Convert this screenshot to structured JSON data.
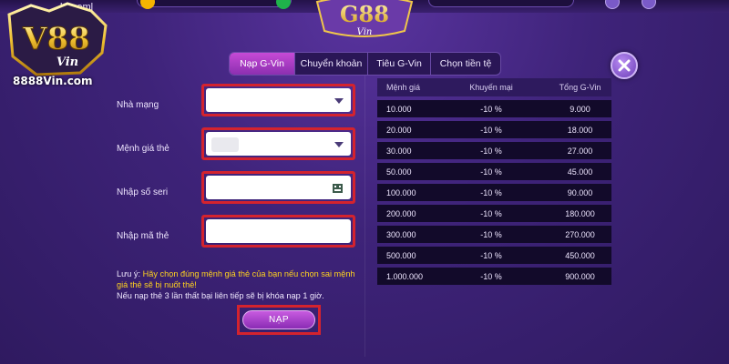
{
  "header": {
    "username": "beneml",
    "brand_name": "V88",
    "brand_sub": "Vin",
    "brand_site": "8888Vin.com",
    "game_logo": "G88",
    "game_logo_sub": "Vin"
  },
  "tabs": [
    {
      "label": "Nạp G-Vin",
      "active": true
    },
    {
      "label": "Chuyển khoản",
      "active": false
    },
    {
      "label": "Tiêu G-Vin",
      "active": false
    },
    {
      "label": "Chọn tiền tệ",
      "active": false
    }
  ],
  "form": {
    "network_label": "Nhà mạng",
    "network_value": "",
    "denomination_label": "Mệnh giá thẻ",
    "denomination_value": "",
    "serial_label": "Nhập số seri",
    "serial_value": "",
    "code_label": "Nhập mã thẻ",
    "code_value": "",
    "note_prefix": "Lưu ý: ",
    "note_warning": "Hãy chọn đúng mệnh giá thẻ của bạn nếu chọn sai mệnh giá thẻ sẽ bị nuốt thẻ!",
    "note_lock": "Nếu nạp thẻ 3 lần thất bại liên tiếp sẽ bị khóa nạp 1 giờ.",
    "submit_label": "NẠP"
  },
  "rate_table": {
    "headers": [
      "Mệnh giá",
      "Khuyến mại",
      "Tổng G-Vin"
    ],
    "rows": [
      [
        "10.000",
        "-10 %",
        "9.000"
      ],
      [
        "20.000",
        "-10 %",
        "18.000"
      ],
      [
        "30.000",
        "-10 %",
        "27.000"
      ],
      [
        "50.000",
        "-10 %",
        "45.000"
      ],
      [
        "100.000",
        "-10 %",
        "90.000"
      ],
      [
        "200.000",
        "-10 %",
        "180.000"
      ],
      [
        "300.000",
        "-10 %",
        "270.000"
      ],
      [
        "500.000",
        "-10 %",
        "450.000"
      ],
      [
        "1.000.000",
        "-10 %",
        "900.000"
      ]
    ]
  },
  "colors": {
    "background": "#3e2379",
    "accent": "#c64ad6",
    "highlight_border": "#d4232e",
    "warning_text": "#ffd21f"
  },
  "icons": {
    "close": "close-icon",
    "dropdown": "chevron-down-icon",
    "scan": "scan-icon"
  }
}
